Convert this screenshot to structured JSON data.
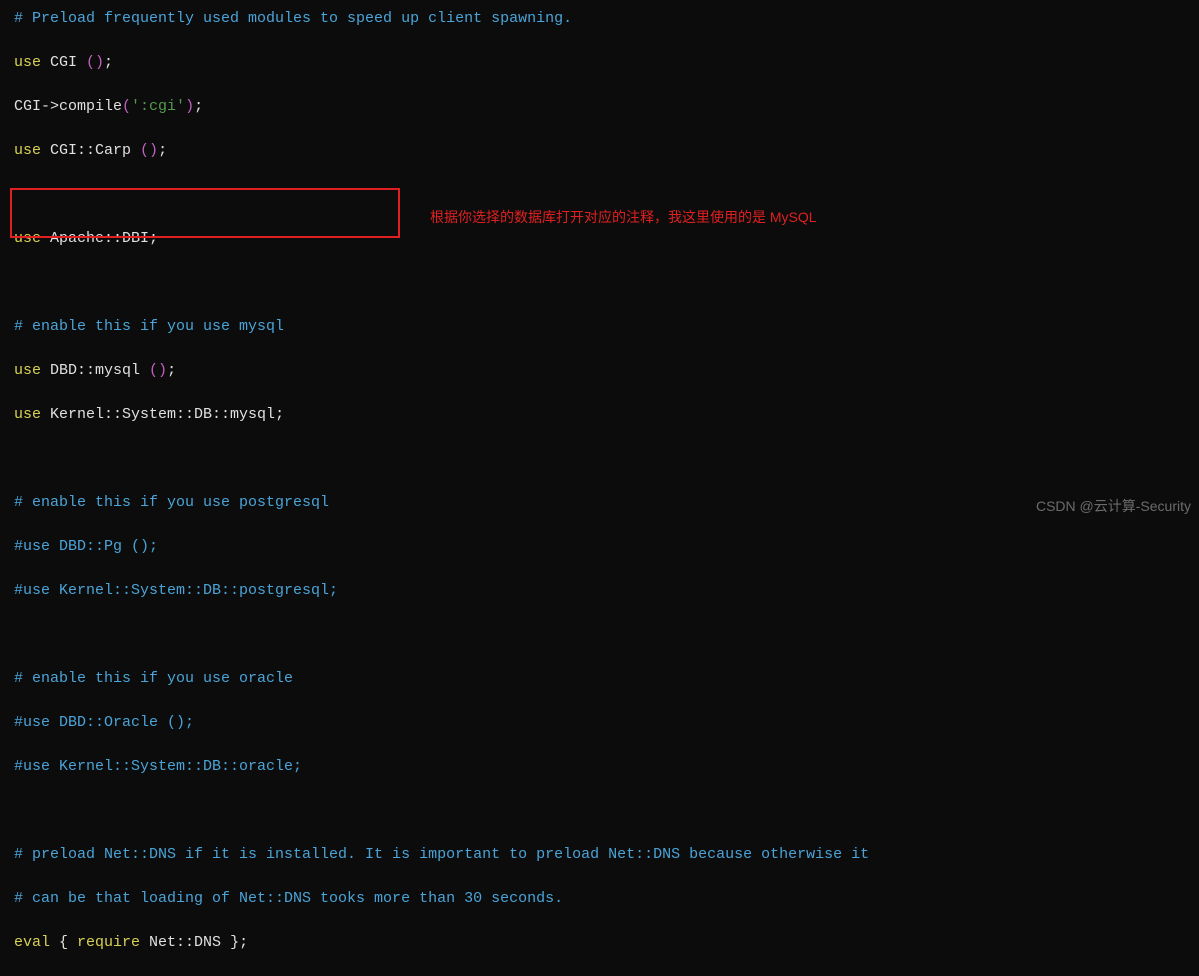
{
  "code": {
    "l1": "# Preload frequently used modules to speed up client spawning.",
    "use1_kw": "use",
    "use1_mod": " CGI ",
    "use1_par": "()",
    "use1_semi": ";",
    "l3a": "CGI->compile",
    "l3p1": "(",
    "l3s": "':cgi'",
    "l3p2": ")",
    "l3semi": ";",
    "use2_kw": "use",
    "use2_mod": " CGI::Carp ",
    "use2_par": "()",
    "use2_semi": ";",
    "use3_kw": "use",
    "use3_mod": " Apache::DBI",
    "use3_semi": ";",
    "l8": "# enable this if you use mysql",
    "use4_kw": "use",
    "use4_mod": " DBD::mysql ",
    "use4_par": "()",
    "use4_semi": ";",
    "use5_kw": "use",
    "use5_mod": " Kernel::System::DB::mysql",
    "use5_semi": ";",
    "l12": "# enable this if you use postgresql",
    "l13": "#use DBD::Pg ();",
    "l14": "#use Kernel::System::DB::postgresql;",
    "l16": "# enable this if you use oracle",
    "l17": "#use DBD::Oracle ();",
    "l18": "#use Kernel::System::DB::oracle;",
    "l20": "# preload Net::DNS if it is installed. It is important to preload Net::DNS because otherwise it",
    "l21": "# can be that loading of Net::DNS tooks more than 30 seconds.",
    "eval_kw": "eval",
    "eval_o": " { ",
    "req_kw": "require",
    "req_mod": " Net::DNS ",
    "eval_c": "}",
    "eval_semi": ";"
  },
  "annotation": "根据你选择的数据库打开对应的注释，我这里使用的是 MySQL",
  "watermark": "CSDN @云计算-Security"
}
